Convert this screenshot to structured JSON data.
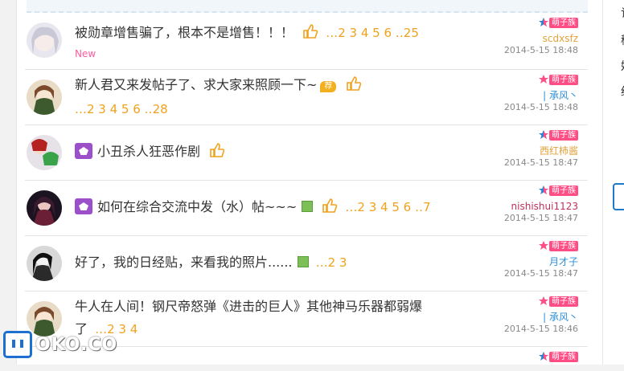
{
  "threads": [
    {
      "title": "被勋章增售骗了，根本不是增售！！！",
      "pages": "…2 3 4 5 6 ‥25",
      "new": "New",
      "user": "scdxsfz",
      "user_color": "#e2a23b",
      "badge": "萌子族",
      "date": "2014-5-15 18:48",
      "avatar": "silver"
    },
    {
      "title": "新人君又来发帖子了、求大家来照顾一下~",
      "hot": "荐",
      "pages": "…2 3 4 5 6 ‥28",
      "user": "| 承风丶",
      "user_color": "#2e8fd8",
      "badge": "萌子族",
      "date": "2014-5-15 18:48",
      "avatar": "green"
    },
    {
      "title": "小丑杀人狂恶作剧",
      "user": "西红柿酱",
      "user_color": "#e2a23b",
      "badge": "萌子族",
      "date": "2014-5-15 18:47",
      "avatar": "red"
    },
    {
      "title": "如何在综合交流中发（水）帖~~~",
      "pages": "…2 3 4 5 6 ‥7",
      "user": "nishishui1123",
      "user_color": "#c0305a",
      "badge": "萌子族",
      "date": "2014-5-15 18:47",
      "avatar": "dark"
    },
    {
      "title": "好了，我的日经贴，来看我的照片......",
      "pages": "…2 3",
      "user": "月才子",
      "user_color": "#2e8fd8",
      "badge": "萌子族",
      "date": "2014-5-15 18:47",
      "avatar": "bw"
    },
    {
      "title": "牛人在人间！钢尺帝怒弹《进击的巨人》其他神马乐器都弱爆",
      "title2": "了",
      "pages": "…2 3 4",
      "user": "| 承风丶",
      "user_color": "#2e8fd8",
      "badge": "萌子族",
      "date": "2014-5-15 18:46",
      "avatar": "green"
    },
    {
      "badge": "萌子族"
    }
  ],
  "side_chars": [
    "记",
    "稀",
    "妹",
    "统"
  ],
  "watermark": "OKO.CO"
}
